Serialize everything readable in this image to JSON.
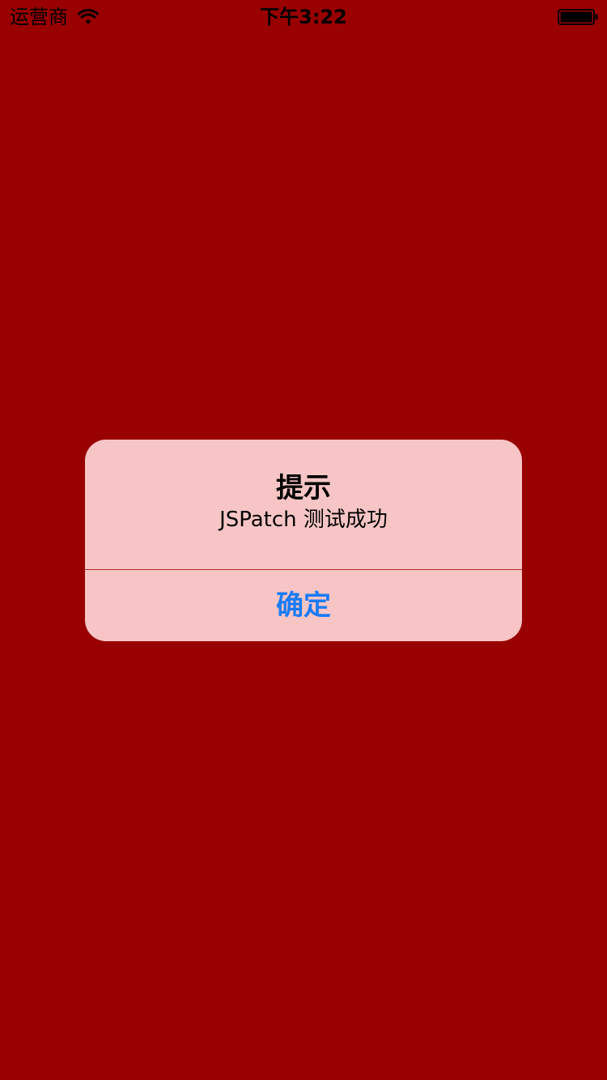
{
  "status_bar": {
    "carrier": "运营商",
    "time": "下午3:22",
    "wifi_icon": "wifi-icon",
    "battery_icon": "battery-full-icon"
  },
  "alert": {
    "title": "提示",
    "message": "JSPatch 测试成功",
    "confirm_label": "确定"
  },
  "colors": {
    "background": "#990000",
    "alert_background": "#f7c5c5",
    "button_text": "#1a7bf5",
    "divider": "#b52a2a"
  }
}
